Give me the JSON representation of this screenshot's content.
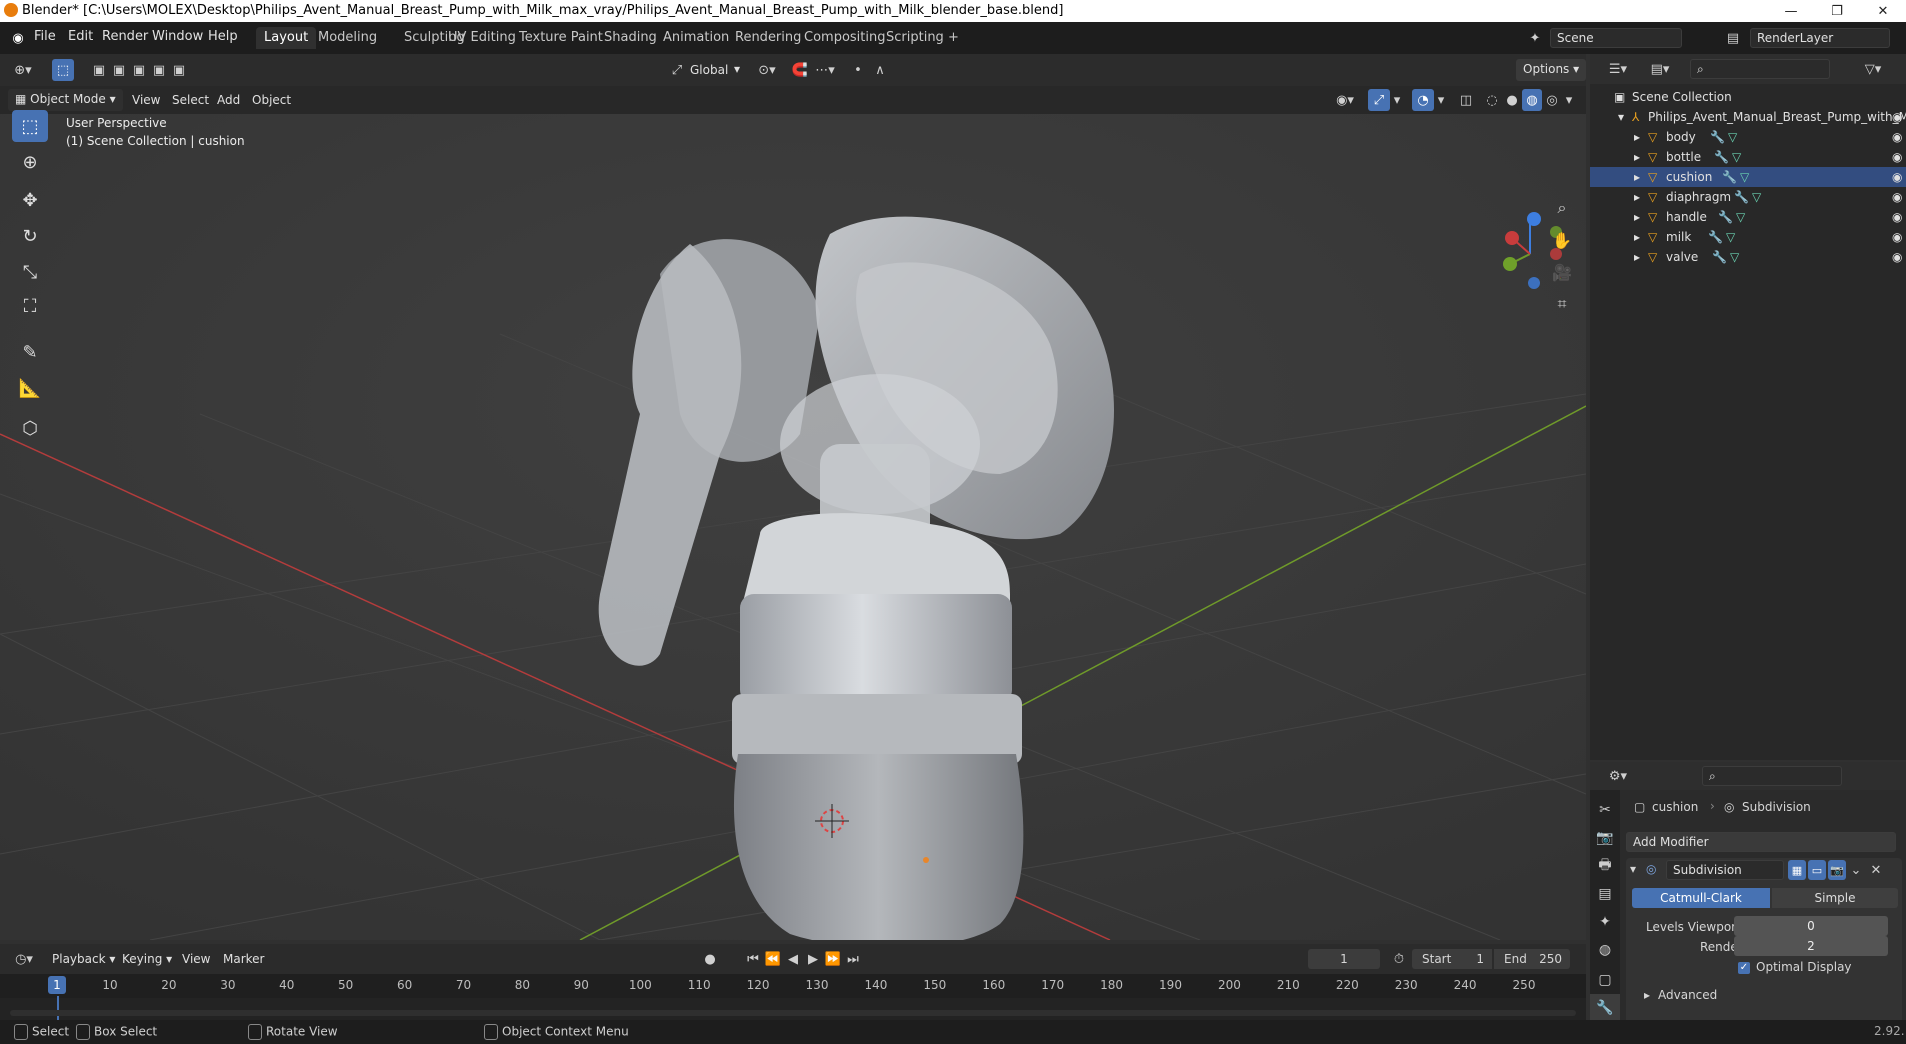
{
  "window": {
    "title": "Blender* [C:\\Users\\MOLEX\\Desktop\\Philips_Avent_Manual_Breast_Pump_with_Milk_max_vray/Philips_Avent_Manual_Breast_Pump_with_Milk_blender_base.blend]",
    "minimize": "—",
    "maximize": "❐",
    "close": "✕"
  },
  "menu": [
    "File",
    "Edit",
    "Render",
    "Window",
    "Help"
  ],
  "workspaces": [
    "Layout",
    "Modeling",
    "Sculpting",
    "UV Editing",
    "Texture Paint",
    "Shading",
    "Animation",
    "Rendering",
    "Compositing",
    "Scripting"
  ],
  "workspace_add": "+",
  "scene": {
    "name": "Scene",
    "view_layer": "RenderLayer"
  },
  "header": {
    "orientation": "Global",
    "options": "Options",
    "mode": "Object Mode",
    "menus": [
      "View",
      "Select",
      "Add",
      "Object"
    ]
  },
  "viewport": {
    "perspective": "User Perspective",
    "collection_info": "(1) Scene Collection | cushion",
    "gizmo": {
      "x": "X",
      "y": "Y",
      "z": "Z"
    }
  },
  "outliner": {
    "root": "Scene Collection",
    "object": "Philips_Avent_Manual_Breast_Pump_with_M",
    "children": [
      "body",
      "bottle",
      "cushion",
      "diaphragm",
      "handle",
      "milk",
      "valve"
    ],
    "selected": "cushion"
  },
  "properties": {
    "object": "cushion",
    "modifier_tab": "Subdivision",
    "add_modifier": "Add Modifier",
    "modifier_name": "Subdivision",
    "mode_catmull": "Catmull-Clark",
    "mode_simple": "Simple",
    "levels_viewport_label": "Levels Viewport",
    "levels_viewport": "0",
    "render_label": "Render",
    "render_value": "2",
    "optimal_display": "Optimal Display",
    "advanced": "Advanced"
  },
  "timeline": {
    "menus": [
      "Playback",
      "Keying",
      "View",
      "Marker"
    ],
    "current_frame": "1",
    "start_label": "Start",
    "start": "1",
    "end_label": "End",
    "end": "250",
    "ticks": [
      "1",
      "10",
      "20",
      "30",
      "40",
      "50",
      "60",
      "70",
      "80",
      "90",
      "100",
      "110",
      "120",
      "130",
      "140",
      "150",
      "160",
      "170",
      "180",
      "190",
      "200",
      "210",
      "220",
      "230",
      "240",
      "250"
    ]
  },
  "status": {
    "select": "Select",
    "box_select": "Box Select",
    "rotate_view": "Rotate View",
    "context_menu": "Object Context Menu",
    "version": "2.92."
  },
  "colors": {
    "accent": "#4772b3",
    "x_axis": "#c83c3c",
    "y_axis": "#6fa02a",
    "z_axis": "#3d7ee0",
    "object_origin": "#e8862a"
  }
}
